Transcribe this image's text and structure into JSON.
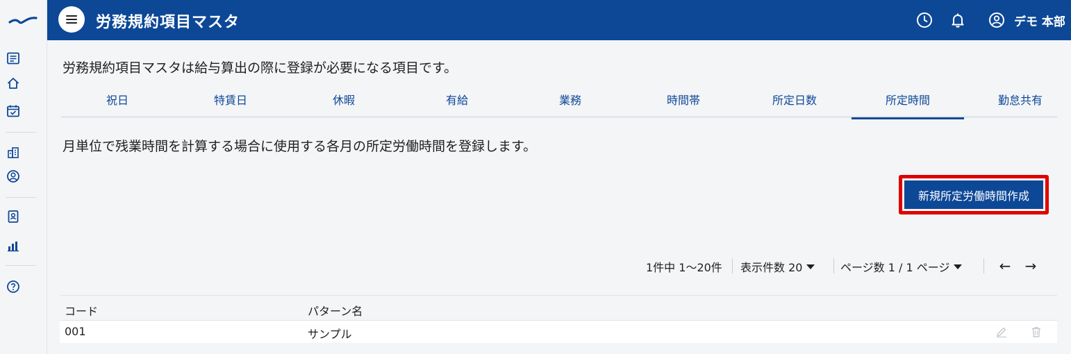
{
  "header": {
    "title": "労務規約項目マスタ",
    "user_name": "デモ 本部",
    "icons": [
      "history-icon",
      "bell-icon",
      "user-circle-icon"
    ]
  },
  "sidebar": {
    "icons": [
      "logo-icon",
      "list-icon",
      "home-icon",
      "calendar-check-icon",
      "building-icon",
      "user-circle-icon",
      "id-badge-icon",
      "bar-chart-icon",
      "help-icon"
    ]
  },
  "intro_text": "労務規約項目マスタは給与算出の際に登録が必要になる項目です。",
  "tabs": [
    {
      "label": "祝日"
    },
    {
      "label": "特賃日"
    },
    {
      "label": "休暇"
    },
    {
      "label": "有給"
    },
    {
      "label": "業務"
    },
    {
      "label": "時間帯"
    },
    {
      "label": "所定日数"
    },
    {
      "label": "所定時間",
      "active": true
    },
    {
      "label": "勤怠共有"
    }
  ],
  "description": "月単位で残業時間を計算する場合に使用する各月の所定労働時間を登録します。",
  "create_button_label": "新規所定労働時間作成",
  "pager": {
    "count_text": "1件中 1〜20件",
    "per_page_label": "表示件数 20",
    "page_label": "ページ数 1 / 1 ページ",
    "prev": "←",
    "next": "→"
  },
  "table": {
    "headers": [
      "コード",
      "パターン名"
    ],
    "rows": [
      {
        "code": "001",
        "name": "サンプル"
      }
    ]
  },
  "colors": {
    "primary": "#0d4897",
    "highlight": "#e00000",
    "background": "#f4f5f7"
  }
}
